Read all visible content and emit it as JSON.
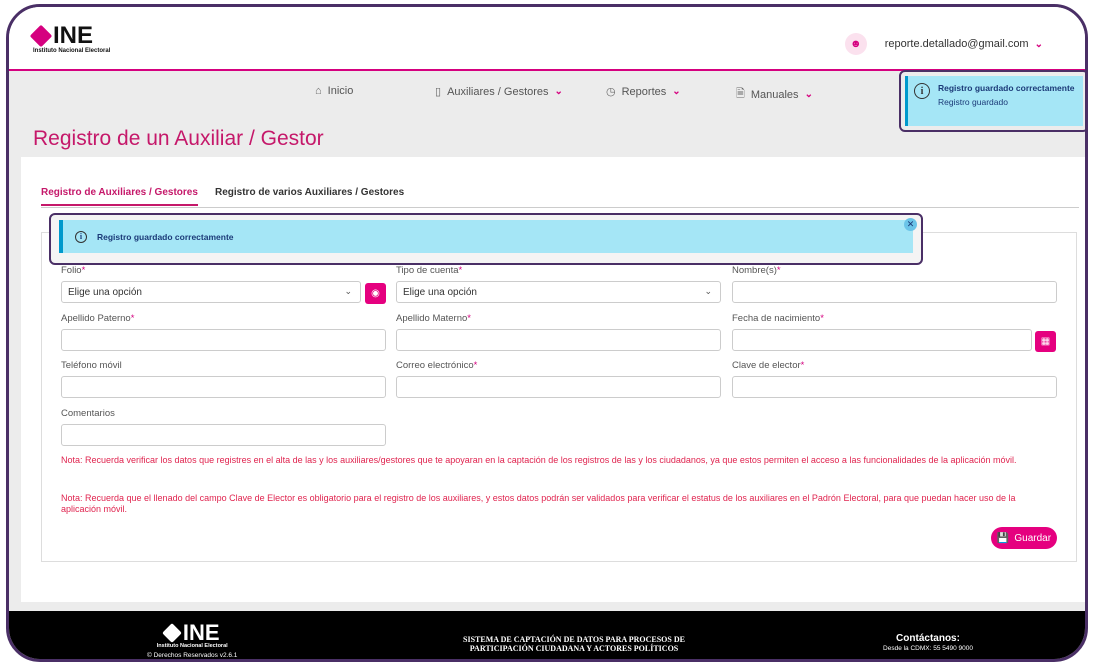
{
  "header": {
    "logo_text": "INE",
    "logo_sub": "Instituto Nacional Electoral",
    "user_email": "reporte.detallado@gmail.com"
  },
  "nav": {
    "items": [
      {
        "label": "Inicio",
        "icon": "home-icon"
      },
      {
        "label": "Auxiliares / Gestores",
        "icon": "tablet-icon"
      },
      {
        "label": "Reportes",
        "icon": "clock-icon"
      },
      {
        "label": "Manuales",
        "icon": "document-icon"
      }
    ]
  },
  "toast": {
    "title": "Registro guardado correctamente",
    "message": "Registro guardado"
  },
  "page_title": "Registro de un Auxiliar / Gestor",
  "tabs": [
    {
      "label": "Registro de Auxiliares / Gestores",
      "active": true
    },
    {
      "label": "Registro de varios Auxiliares / Gestores",
      "active": false
    }
  ],
  "alert": {
    "message": "Registro guardado correctamente"
  },
  "form": {
    "folio": {
      "label": "Folio",
      "value": "Elige una opción"
    },
    "tipo_cuenta": {
      "label": "Tipo de cuenta",
      "value": "Elige una opción"
    },
    "nombre": {
      "label": "Nombre(s)"
    },
    "apellido_paterno": {
      "label": "Apellido Paterno"
    },
    "apellido_materno": {
      "label": "Apellido Materno"
    },
    "fecha_nacimiento": {
      "label": "Fecha de nacimiento"
    },
    "telefono": {
      "label": "Teléfono móvil"
    },
    "correo": {
      "label": "Correo electrónico"
    },
    "clave_elector": {
      "label": "Clave de elector"
    },
    "comentarios": {
      "label": "Comentarios"
    },
    "required_mark": "*"
  },
  "notes": [
    "Nota: Recuerda verificar los datos que registres en el alta de las y los auxiliares/gestores que te apoyaran en la captación de los registros de las y los ciudadanos, ya que estos permiten el acceso a las funcionalidades de la aplicación móvil.",
    "Nota: Recuerda que el llenado del campo Clave de Elector es obligatorio para el registro de los auxiliares, y estos datos podrán ser validados para verificar el estatus de los auxiliares en el Padrón Electoral, para que puedan hacer uso de la aplicación móvil."
  ],
  "save_label": "Guardar",
  "footer": {
    "logo_text": "INE",
    "logo_sub": "Instituto Nacional Electoral",
    "rights": "© Derechos Reservados v2.6.1",
    "system_line1": "SISTEMA DE CAPTACIÓN DE DATOS PARA PROCESOS DE",
    "system_line2": "PARTICIPACIÓN CIUDADANA Y ACTORES POLÍTICOS",
    "contact_title": "Contáctanos:",
    "contact_phone": "Desde la CDMX: 55 5490 9000"
  },
  "colors": {
    "brand": "#d5007f",
    "title": "#c5186a",
    "alert_bg": "#a5e6f6",
    "note": "#e0244f"
  }
}
